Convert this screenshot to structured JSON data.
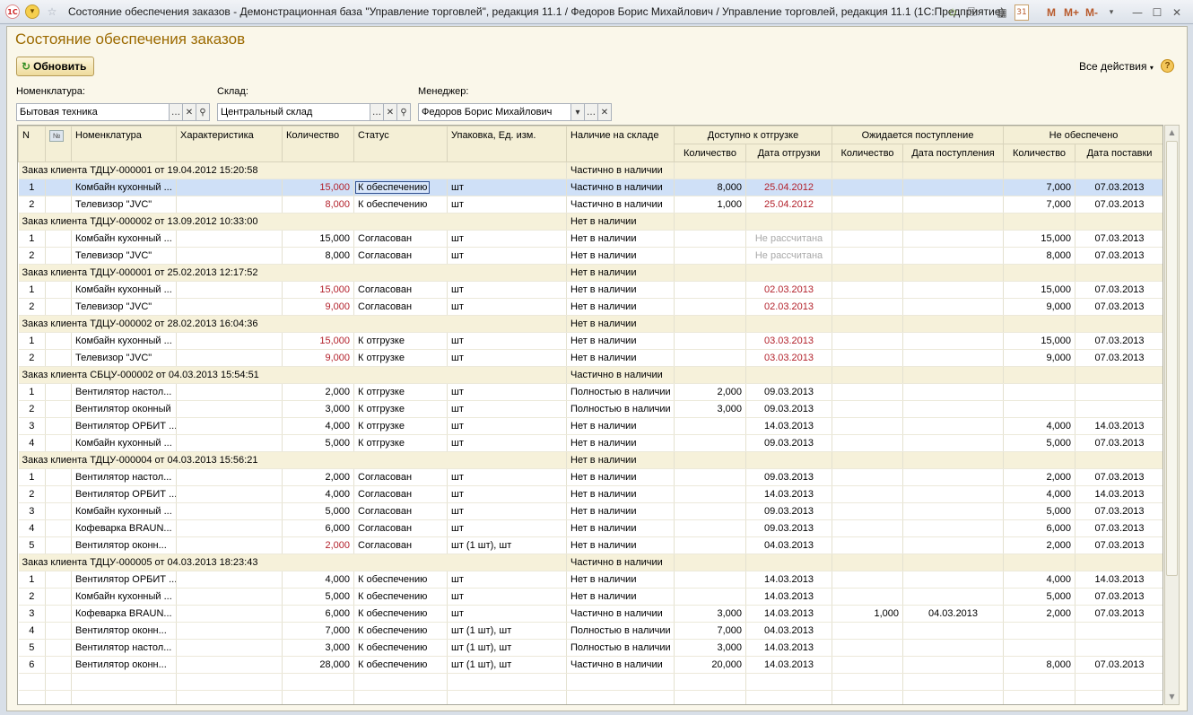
{
  "window": {
    "title": "Состояние обеспечения заказов - Демонстрационная база \"Управление торговлей\", редакция 11.1 / Федоров Борис Михайлович / Управление торговлей, редакция 11.1  (1С:Предприятие)",
    "logo_text": "1С",
    "m_label": "M",
    "m_plus_label": "M+",
    "m_minus_label": "M-",
    "calendar_day": "31"
  },
  "form": {
    "title": "Состояние обеспечения заказов",
    "refresh_label": "Обновить",
    "all_actions_label": "Все действия",
    "help_label": "?"
  },
  "filters": {
    "nomenclature": {
      "label": "Номенклатура:",
      "value": "Бытовая техника"
    },
    "warehouse": {
      "label": "Склад:",
      "value": "Центральный склад"
    },
    "manager": {
      "label": "Менеджер:",
      "value": "Федоров Борис Михайлович"
    }
  },
  "table": {
    "headers": {
      "n": "N",
      "num_icon": "№",
      "nomenclature": "Номенклатура",
      "characteristic": "Характеристика",
      "quantity": "Количество",
      "status": "Статус",
      "packaging": "Упаковка, Ед. изм.",
      "availability": "Наличие на складе",
      "available_group": "Доступно к отгрузке",
      "expected_group": "Ожидается поступление",
      "unsecured_group": "Не обеспечено",
      "sub_quantity": "Количество",
      "sub_ship_date": "Дата отгрузки",
      "sub_receipt_date": "Дата поступления",
      "sub_delivery_date": "Дата поставки"
    },
    "groups": [
      {
        "title": "Заказ клиента ТДЦУ-000001 от 19.04.2012 15:20:58",
        "availability": "Частично в наличии",
        "rows": [
          {
            "n": "1",
            "name": "Комбайн кухонный ...",
            "qty": "15,000",
            "qty_red": true,
            "status": "К обеспечению",
            "pack": "шт",
            "avail": "Частично в наличии",
            "ship_qty": "8,000",
            "ship_date": "25.04.2012",
            "date_style": "red",
            "exp_qty": "",
            "exp_date": "",
            "un_qty": "7,000",
            "un_date": "07.03.2013",
            "selected": true
          },
          {
            "n": "2",
            "name": "Телевизор \"JVC\"",
            "qty": "8,000",
            "qty_red": true,
            "status": "К обеспечению",
            "pack": "шт",
            "avail": "Частично в наличии",
            "ship_qty": "1,000",
            "ship_date": "25.04.2012",
            "date_style": "red",
            "exp_qty": "",
            "exp_date": "",
            "un_qty": "7,000",
            "un_date": "07.03.2013"
          }
        ]
      },
      {
        "title": "Заказ клиента ТДЦУ-000002 от 13.09.2012 10:33:00",
        "availability": "Нет в наличии",
        "rows": [
          {
            "n": "1",
            "name": "Комбайн кухонный ...",
            "qty": "15,000",
            "status": "Согласован",
            "pack": "шт",
            "avail": "Нет в наличии",
            "ship_qty": "",
            "ship_date": "Не рассчитана",
            "date_style": "gray",
            "exp_qty": "",
            "exp_date": "",
            "un_qty": "15,000",
            "un_date": "07.03.2013"
          },
          {
            "n": "2",
            "name": "Телевизор \"JVC\"",
            "qty": "8,000",
            "status": "Согласован",
            "pack": "шт",
            "avail": "Нет в наличии",
            "ship_qty": "",
            "ship_date": "Не рассчитана",
            "date_style": "gray",
            "exp_qty": "",
            "exp_date": "",
            "un_qty": "8,000",
            "un_date": "07.03.2013"
          }
        ]
      },
      {
        "title": "Заказ клиента ТДЦУ-000001 от 25.02.2013 12:17:52",
        "availability": "Нет в наличии",
        "rows": [
          {
            "n": "1",
            "name": "Комбайн кухонный ...",
            "qty": "15,000",
            "qty_red": true,
            "status": "Согласован",
            "pack": "шт",
            "avail": "Нет в наличии",
            "ship_qty": "",
            "ship_date": "02.03.2013",
            "date_style": "red",
            "exp_qty": "",
            "exp_date": "",
            "un_qty": "15,000",
            "un_date": "07.03.2013"
          },
          {
            "n": "2",
            "name": "Телевизор \"JVC\"",
            "qty": "9,000",
            "qty_red": true,
            "status": "Согласован",
            "pack": "шт",
            "avail": "Нет в наличии",
            "ship_qty": "",
            "ship_date": "02.03.2013",
            "date_style": "red",
            "exp_qty": "",
            "exp_date": "",
            "un_qty": "9,000",
            "un_date": "07.03.2013"
          }
        ]
      },
      {
        "title": "Заказ клиента ТДЦУ-000002 от 28.02.2013 16:04:36",
        "availability": "Нет в наличии",
        "rows": [
          {
            "n": "1",
            "name": "Комбайн кухонный ...",
            "qty": "15,000",
            "qty_red": true,
            "status": "К отгрузке",
            "pack": "шт",
            "avail": "Нет в наличии",
            "ship_qty": "",
            "ship_date": "03.03.2013",
            "date_style": "red",
            "exp_qty": "",
            "exp_date": "",
            "un_qty": "15,000",
            "un_date": "07.03.2013"
          },
          {
            "n": "2",
            "name": "Телевизор \"JVC\"",
            "qty": "9,000",
            "qty_red": true,
            "status": "К отгрузке",
            "pack": "шт",
            "avail": "Нет в наличии",
            "ship_qty": "",
            "ship_date": "03.03.2013",
            "date_style": "red",
            "exp_qty": "",
            "exp_date": "",
            "un_qty": "9,000",
            "un_date": "07.03.2013"
          }
        ]
      },
      {
        "title": "Заказ клиента СБЦУ-000002 от 04.03.2013 15:54:51",
        "availability": "Частично в наличии",
        "rows": [
          {
            "n": "1",
            "name": "Вентилятор настол...",
            "qty": "2,000",
            "status": "К отгрузке",
            "pack": "шт",
            "avail": "Полностью в наличии",
            "ship_qty": "2,000",
            "ship_date": "09.03.2013",
            "exp_qty": "",
            "exp_date": "",
            "un_qty": "",
            "un_date": ""
          },
          {
            "n": "2",
            "name": "Вентилятор оконный",
            "qty": "3,000",
            "status": "К отгрузке",
            "pack": "шт",
            "avail": "Полностью в наличии",
            "ship_qty": "3,000",
            "ship_date": "09.03.2013",
            "exp_qty": "",
            "exp_date": "",
            "un_qty": "",
            "un_date": ""
          },
          {
            "n": "3",
            "name": "Вентилятор ОРБИТ ...",
            "qty": "4,000",
            "status": "К отгрузке",
            "pack": "шт",
            "avail": "Нет в наличии",
            "ship_qty": "",
            "ship_date": "14.03.2013",
            "exp_qty": "",
            "exp_date": "",
            "un_qty": "4,000",
            "un_date": "14.03.2013"
          },
          {
            "n": "4",
            "name": "Комбайн кухонный ...",
            "qty": "5,000",
            "status": "К отгрузке",
            "pack": "шт",
            "avail": "Нет в наличии",
            "ship_qty": "",
            "ship_date": "09.03.2013",
            "exp_qty": "",
            "exp_date": "",
            "un_qty": "5,000",
            "un_date": "07.03.2013"
          }
        ]
      },
      {
        "title": "Заказ клиента ТДЦУ-000004 от 04.03.2013 15:56:21",
        "availability": "Нет в наличии",
        "rows": [
          {
            "n": "1",
            "name": "Вентилятор настол...",
            "qty": "2,000",
            "status": "Согласован",
            "pack": "шт",
            "avail": "Нет в наличии",
            "ship_qty": "",
            "ship_date": "09.03.2013",
            "exp_qty": "",
            "exp_date": "",
            "un_qty": "2,000",
            "un_date": "07.03.2013"
          },
          {
            "n": "2",
            "name": "Вентилятор ОРБИТ ...",
            "qty": "4,000",
            "status": "Согласован",
            "pack": "шт",
            "avail": "Нет в наличии",
            "ship_qty": "",
            "ship_date": "14.03.2013",
            "exp_qty": "",
            "exp_date": "",
            "un_qty": "4,000",
            "un_date": "14.03.2013"
          },
          {
            "n": "3",
            "name": "Комбайн кухонный ...",
            "qty": "5,000",
            "status": "Согласован",
            "pack": "шт",
            "avail": "Нет в наличии",
            "ship_qty": "",
            "ship_date": "09.03.2013",
            "exp_qty": "",
            "exp_date": "",
            "un_qty": "5,000",
            "un_date": "07.03.2013"
          },
          {
            "n": "4",
            "name": "Кофеварка BRAUN...",
            "qty": "6,000",
            "status": "Согласован",
            "pack": "шт",
            "avail": "Нет в наличии",
            "ship_qty": "",
            "ship_date": "09.03.2013",
            "exp_qty": "",
            "exp_date": "",
            "un_qty": "6,000",
            "un_date": "07.03.2013"
          },
          {
            "n": "5",
            "name": "Вентилятор оконн...",
            "qty": "2,000",
            "qty_red": true,
            "status": "Согласован",
            "pack": "шт (1 шт), шт",
            "avail": "Нет в наличии",
            "ship_qty": "",
            "ship_date": "04.03.2013",
            "exp_qty": "",
            "exp_date": "",
            "un_qty": "2,000",
            "un_date": "07.03.2013"
          }
        ]
      },
      {
        "title": "Заказ клиента ТДЦУ-000005 от 04.03.2013 18:23:43",
        "availability": "Частично в наличии",
        "rows": [
          {
            "n": "1",
            "name": "Вентилятор ОРБИТ ...",
            "qty": "4,000",
            "status": "К обеспечению",
            "pack": "шт",
            "avail": "Нет в наличии",
            "ship_qty": "",
            "ship_date": "14.03.2013",
            "exp_qty": "",
            "exp_date": "",
            "un_qty": "4,000",
            "un_date": "14.03.2013"
          },
          {
            "n": "2",
            "name": "Комбайн кухонный ...",
            "qty": "5,000",
            "status": "К обеспечению",
            "pack": "шт",
            "avail": "Нет в наличии",
            "ship_qty": "",
            "ship_date": "14.03.2013",
            "exp_qty": "",
            "exp_date": "",
            "un_qty": "5,000",
            "un_date": "07.03.2013"
          },
          {
            "n": "3",
            "name": "Кофеварка BRAUN...",
            "qty": "6,000",
            "status": "К обеспечению",
            "pack": "шт",
            "avail": "Частично в наличии",
            "ship_qty": "3,000",
            "ship_date": "14.03.2013",
            "exp_qty": "1,000",
            "exp_date": "04.03.2013",
            "un_qty": "2,000",
            "un_date": "07.03.2013"
          },
          {
            "n": "4",
            "name": "Вентилятор оконн...",
            "qty": "7,000",
            "status": "К обеспечению",
            "pack": "шт (1 шт), шт",
            "avail": "Полностью в наличии",
            "ship_qty": "7,000",
            "ship_date": "04.03.2013",
            "exp_qty": "",
            "exp_date": "",
            "un_qty": "",
            "un_date": ""
          },
          {
            "n": "5",
            "name": "Вентилятор настол...",
            "qty": "3,000",
            "status": "К обеспечению",
            "pack": "шт (1 шт), шт",
            "avail": "Полностью в наличии",
            "ship_qty": "3,000",
            "ship_date": "14.03.2013",
            "exp_qty": "",
            "exp_date": "",
            "un_qty": "",
            "un_date": ""
          },
          {
            "n": "6",
            "name": "Вентилятор оконн...",
            "qty": "28,000",
            "status": "К обеспечению",
            "pack": "шт (1 шт), шт",
            "avail": "Частично в наличии",
            "ship_qty": "20,000",
            "ship_date": "14.03.2013",
            "exp_qty": "",
            "exp_date": "",
            "un_qty": "8,000",
            "un_date": "07.03.2013"
          }
        ]
      }
    ]
  },
  "colors": {
    "accent_title": "#9c6a00",
    "alert_red": "#b3222c",
    "muted_gray": "#a9a9a9",
    "selection": "#cfe0f7",
    "group_row": "#f6f1da"
  },
  "icons": [
    "app-logo-icon",
    "menu-icon",
    "favorite-star-icon",
    "add-favorite-icon",
    "history-icon",
    "calculator-icon",
    "calendar-icon",
    "minimize-icon",
    "maximize-icon",
    "close-icon",
    "refresh-icon",
    "dropdown-arrow-icon",
    "help-icon",
    "select-ellipsis-icon",
    "clear-icon",
    "search-icon"
  ]
}
